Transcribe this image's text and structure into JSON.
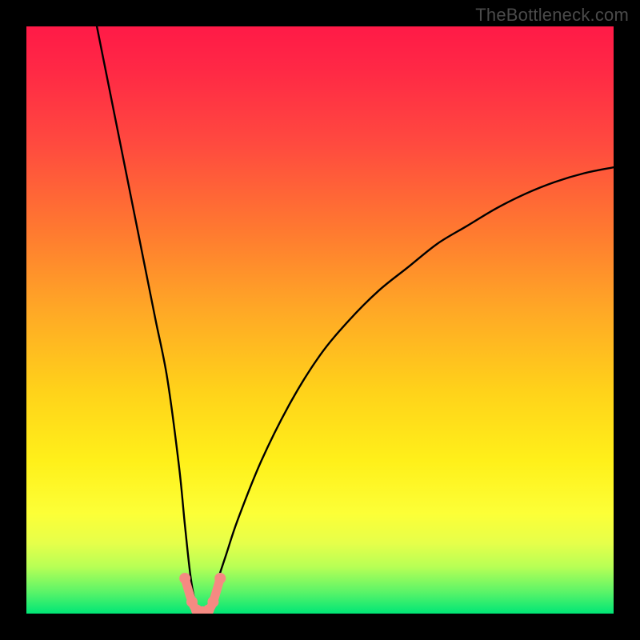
{
  "watermark": "TheBottleneck.com",
  "chart_data": {
    "type": "line",
    "title": "",
    "xlabel": "",
    "ylabel": "",
    "xlim": [
      0,
      100
    ],
    "ylim": [
      0,
      100
    ],
    "grid": false,
    "series": [
      {
        "name": "bottleneck-curve",
        "color": "#000000",
        "x": [
          12,
          14,
          16,
          18,
          20,
          22,
          24,
          26,
          27,
          28,
          29,
          30,
          31,
          32,
          34,
          36,
          40,
          45,
          50,
          55,
          60,
          65,
          70,
          75,
          80,
          85,
          90,
          95,
          100
        ],
        "y": [
          100,
          90,
          80,
          70,
          60,
          50,
          40,
          25,
          15,
          6,
          1,
          0,
          1,
          4,
          10,
          16,
          26,
          36,
          44,
          50,
          55,
          59,
          63,
          66,
          69,
          71.5,
          73.5,
          75,
          76
        ]
      },
      {
        "name": "marker-points",
        "color": "#f58a82",
        "type": "scatter",
        "x": [
          27.0,
          28.2,
          29.0,
          30.0,
          31.0,
          31.8,
          33.0
        ],
        "y": [
          6.0,
          2.0,
          0.6,
          0.3,
          0.6,
          2.0,
          6.0
        ]
      }
    ],
    "annotations": []
  }
}
